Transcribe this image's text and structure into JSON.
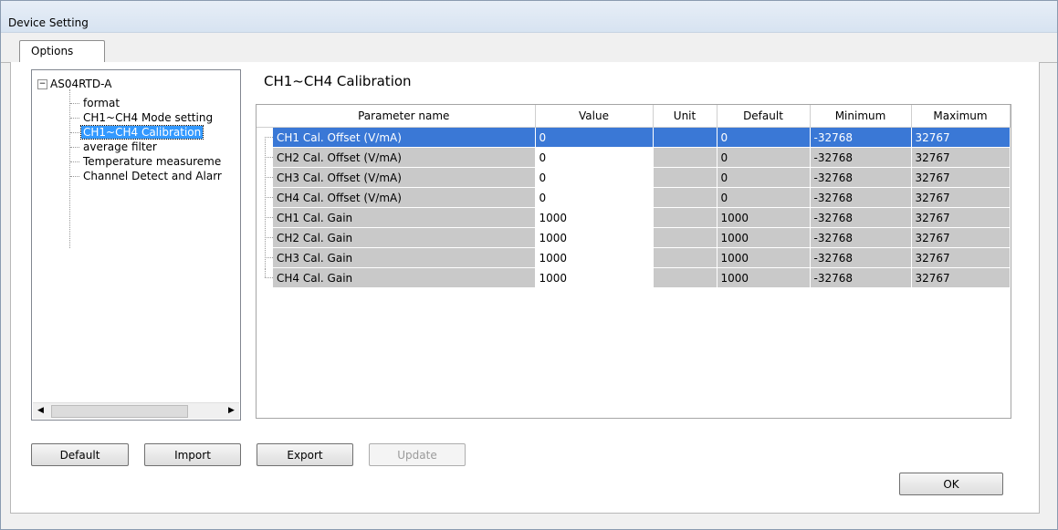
{
  "window": {
    "title": "Device Setting"
  },
  "tabs": [
    {
      "label": "Options"
    }
  ],
  "tree": {
    "root": "AS04RTD-A",
    "items": [
      {
        "label": "format"
      },
      {
        "label": "CH1~CH4 Mode setting"
      },
      {
        "label": "CH1~CH4 Calibration",
        "selected": true
      },
      {
        "label": "average filter"
      },
      {
        "label": "Temperature measureme"
      },
      {
        "label": "Channel Detect and Alarr"
      }
    ]
  },
  "section": {
    "title": "CH1~CH4 Calibration"
  },
  "grid": {
    "headers": [
      "Parameter name",
      "Value",
      "Unit",
      "Default",
      "Minimum",
      "Maximum"
    ],
    "rows": [
      {
        "name": "CH1 Cal. Offset (V/mA)",
        "value": "0",
        "unit": "",
        "default": "0",
        "min": "-32768",
        "max": "32767"
      },
      {
        "name": "CH2 Cal. Offset (V/mA)",
        "value": "0",
        "unit": "",
        "default": "0",
        "min": "-32768",
        "max": "32767"
      },
      {
        "name": "CH3 Cal. Offset (V/mA)",
        "value": "0",
        "unit": "",
        "default": "0",
        "min": "-32768",
        "max": "32767"
      },
      {
        "name": "CH4 Cal. Offset (V/mA)",
        "value": "0",
        "unit": "",
        "default": "0",
        "min": "-32768",
        "max": "32767"
      },
      {
        "name": "CH1 Cal. Gain",
        "value": "1000",
        "unit": "",
        "default": "1000",
        "min": "-32768",
        "max": "32767"
      },
      {
        "name": "CH2 Cal. Gain",
        "value": "1000",
        "unit": "",
        "default": "1000",
        "min": "-32768",
        "max": "32767"
      },
      {
        "name": "CH3 Cal. Gain",
        "value": "1000",
        "unit": "",
        "default": "1000",
        "min": "-32768",
        "max": "32767"
      },
      {
        "name": "CH4 Cal. Gain",
        "value": "1000",
        "unit": "",
        "default": "1000",
        "min": "-32768",
        "max": "32767"
      }
    ],
    "selected_row": 0
  },
  "buttons": {
    "default": "Default",
    "import": "Import",
    "export": "Export",
    "update": "Update",
    "ok": "OK"
  },
  "icons": {
    "tree_expander": "collapse-minus-icon",
    "scroll_left": "arrow-left-icon",
    "scroll_right": "arrow-right-icon"
  },
  "colors": {
    "selection": "#3a78d6",
    "tree_selection": "#3399ff",
    "readonly_cell": "#c9c9c9"
  }
}
